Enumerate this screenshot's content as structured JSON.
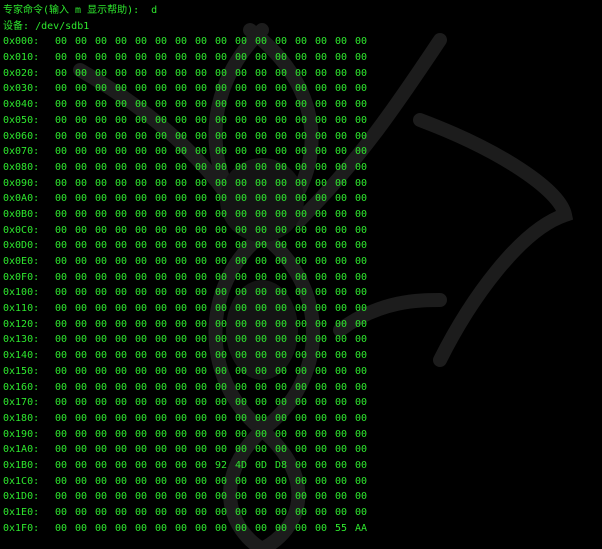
{
  "terminal": {
    "prompt_label": "专家命令(输入 m 显示帮助):",
    "prompt_input": "d",
    "device_label": "设备:",
    "device_value": "/dev/sdb1"
  },
  "colors": {
    "background": "#000000",
    "text": "#2ee82e",
    "watermark": "#1c1c1c"
  },
  "hexdump": {
    "rows": [
      {
        "addr": "0x000:",
        "bytes": [
          "00",
          "00",
          "00",
          "00",
          "00",
          "00",
          "00",
          "00",
          "00",
          "00",
          "00",
          "00",
          "00",
          "00",
          "00",
          "00"
        ]
      },
      {
        "addr": "0x010:",
        "bytes": [
          "00",
          "00",
          "00",
          "00",
          "00",
          "00",
          "00",
          "00",
          "00",
          "00",
          "00",
          "00",
          "00",
          "00",
          "00",
          "00"
        ]
      },
      {
        "addr": "0x020:",
        "bytes": [
          "00",
          "00",
          "00",
          "00",
          "00",
          "00",
          "00",
          "00",
          "00",
          "00",
          "00",
          "00",
          "00",
          "00",
          "00",
          "00"
        ]
      },
      {
        "addr": "0x030:",
        "bytes": [
          "00",
          "00",
          "00",
          "00",
          "00",
          "00",
          "00",
          "00",
          "00",
          "00",
          "00",
          "00",
          "00",
          "00",
          "00",
          "00"
        ]
      },
      {
        "addr": "0x040:",
        "bytes": [
          "00",
          "00",
          "00",
          "00",
          "00",
          "00",
          "00",
          "00",
          "00",
          "00",
          "00",
          "00",
          "00",
          "00",
          "00",
          "00"
        ]
      },
      {
        "addr": "0x050:",
        "bytes": [
          "00",
          "00",
          "00",
          "00",
          "00",
          "00",
          "00",
          "00",
          "00",
          "00",
          "00",
          "00",
          "00",
          "00",
          "00",
          "00"
        ]
      },
      {
        "addr": "0x060:",
        "bytes": [
          "00",
          "00",
          "00",
          "00",
          "00",
          "00",
          "00",
          "00",
          "00",
          "00",
          "00",
          "00",
          "00",
          "00",
          "00",
          "00"
        ]
      },
      {
        "addr": "0x070:",
        "bytes": [
          "00",
          "00",
          "00",
          "00",
          "00",
          "00",
          "00",
          "00",
          "00",
          "00",
          "00",
          "00",
          "00",
          "00",
          "00",
          "00"
        ]
      },
      {
        "addr": "0x080:",
        "bytes": [
          "00",
          "00",
          "00",
          "00",
          "00",
          "00",
          "00",
          "00",
          "00",
          "00",
          "00",
          "00",
          "00",
          "00",
          "00",
          "00"
        ]
      },
      {
        "addr": "0x090:",
        "bytes": [
          "00",
          "00",
          "00",
          "00",
          "00",
          "00",
          "00",
          "00",
          "00",
          "00",
          "00",
          "00",
          "00",
          "00",
          "00",
          "00"
        ]
      },
      {
        "addr": "0x0A0:",
        "bytes": [
          "00",
          "00",
          "00",
          "00",
          "00",
          "00",
          "00",
          "00",
          "00",
          "00",
          "00",
          "00",
          "00",
          "00",
          "00",
          "00"
        ]
      },
      {
        "addr": "0x0B0:",
        "bytes": [
          "00",
          "00",
          "00",
          "00",
          "00",
          "00",
          "00",
          "00",
          "00",
          "00",
          "00",
          "00",
          "00",
          "00",
          "00",
          "00"
        ]
      },
      {
        "addr": "0x0C0:",
        "bytes": [
          "00",
          "00",
          "00",
          "00",
          "00",
          "00",
          "00",
          "00",
          "00",
          "00",
          "00",
          "00",
          "00",
          "00",
          "00",
          "00"
        ]
      },
      {
        "addr": "0x0D0:",
        "bytes": [
          "00",
          "00",
          "00",
          "00",
          "00",
          "00",
          "00",
          "00",
          "00",
          "00",
          "00",
          "00",
          "00",
          "00",
          "00",
          "00"
        ]
      },
      {
        "addr": "0x0E0:",
        "bytes": [
          "00",
          "00",
          "00",
          "00",
          "00",
          "00",
          "00",
          "00",
          "00",
          "00",
          "00",
          "00",
          "00",
          "00",
          "00",
          "00"
        ]
      },
      {
        "addr": "0x0F0:",
        "bytes": [
          "00",
          "00",
          "00",
          "00",
          "00",
          "00",
          "00",
          "00",
          "00",
          "00",
          "00",
          "00",
          "00",
          "00",
          "00",
          "00"
        ]
      },
      {
        "addr": "0x100:",
        "bytes": [
          "00",
          "00",
          "00",
          "00",
          "00",
          "00",
          "00",
          "00",
          "00",
          "00",
          "00",
          "00",
          "00",
          "00",
          "00",
          "00"
        ]
      },
      {
        "addr": "0x110:",
        "bytes": [
          "00",
          "00",
          "00",
          "00",
          "00",
          "00",
          "00",
          "00",
          "00",
          "00",
          "00",
          "00",
          "00",
          "00",
          "00",
          "00"
        ]
      },
      {
        "addr": "0x120:",
        "bytes": [
          "00",
          "00",
          "00",
          "00",
          "00",
          "00",
          "00",
          "00",
          "00",
          "00",
          "00",
          "00",
          "00",
          "00",
          "00",
          "00"
        ]
      },
      {
        "addr": "0x130:",
        "bytes": [
          "00",
          "00",
          "00",
          "00",
          "00",
          "00",
          "00",
          "00",
          "00",
          "00",
          "00",
          "00",
          "00",
          "00",
          "00",
          "00"
        ]
      },
      {
        "addr": "0x140:",
        "bytes": [
          "00",
          "00",
          "00",
          "00",
          "00",
          "00",
          "00",
          "00",
          "00",
          "00",
          "00",
          "00",
          "00",
          "00",
          "00",
          "00"
        ]
      },
      {
        "addr": "0x150:",
        "bytes": [
          "00",
          "00",
          "00",
          "00",
          "00",
          "00",
          "00",
          "00",
          "00",
          "00",
          "00",
          "00",
          "00",
          "00",
          "00",
          "00"
        ]
      },
      {
        "addr": "0x160:",
        "bytes": [
          "00",
          "00",
          "00",
          "00",
          "00",
          "00",
          "00",
          "00",
          "00",
          "00",
          "00",
          "00",
          "00",
          "00",
          "00",
          "00"
        ]
      },
      {
        "addr": "0x170:",
        "bytes": [
          "00",
          "00",
          "00",
          "00",
          "00",
          "00",
          "00",
          "00",
          "00",
          "00",
          "00",
          "00",
          "00",
          "00",
          "00",
          "00"
        ]
      },
      {
        "addr": "0x180:",
        "bytes": [
          "00",
          "00",
          "00",
          "00",
          "00",
          "00",
          "00",
          "00",
          "00",
          "00",
          "00",
          "00",
          "00",
          "00",
          "00",
          "00"
        ]
      },
      {
        "addr": "0x190:",
        "bytes": [
          "00",
          "00",
          "00",
          "00",
          "00",
          "00",
          "00",
          "00",
          "00",
          "00",
          "00",
          "00",
          "00",
          "00",
          "00",
          "00"
        ]
      },
      {
        "addr": "0x1A0:",
        "bytes": [
          "00",
          "00",
          "00",
          "00",
          "00",
          "00",
          "00",
          "00",
          "00",
          "00",
          "00",
          "00",
          "00",
          "00",
          "00",
          "00"
        ]
      },
      {
        "addr": "0x1B0:",
        "bytes": [
          "00",
          "00",
          "00",
          "00",
          "00",
          "00",
          "00",
          "00",
          "92",
          "4D",
          "0D",
          "D8",
          "00",
          "00",
          "00",
          "00"
        ]
      },
      {
        "addr": "0x1C0:",
        "bytes": [
          "00",
          "00",
          "00",
          "00",
          "00",
          "00",
          "00",
          "00",
          "00",
          "00",
          "00",
          "00",
          "00",
          "00",
          "00",
          "00"
        ]
      },
      {
        "addr": "0x1D0:",
        "bytes": [
          "00",
          "00",
          "00",
          "00",
          "00",
          "00",
          "00",
          "00",
          "00",
          "00",
          "00",
          "00",
          "00",
          "00",
          "00",
          "00"
        ]
      },
      {
        "addr": "0x1E0:",
        "bytes": [
          "00",
          "00",
          "00",
          "00",
          "00",
          "00",
          "00",
          "00",
          "00",
          "00",
          "00",
          "00",
          "00",
          "00",
          "00",
          "00"
        ]
      },
      {
        "addr": "0x1F0:",
        "bytes": [
          "00",
          "00",
          "00",
          "00",
          "00",
          "00",
          "00",
          "00",
          "00",
          "00",
          "00",
          "00",
          "00",
          "00",
          "55",
          "AA"
        ]
      }
    ]
  }
}
